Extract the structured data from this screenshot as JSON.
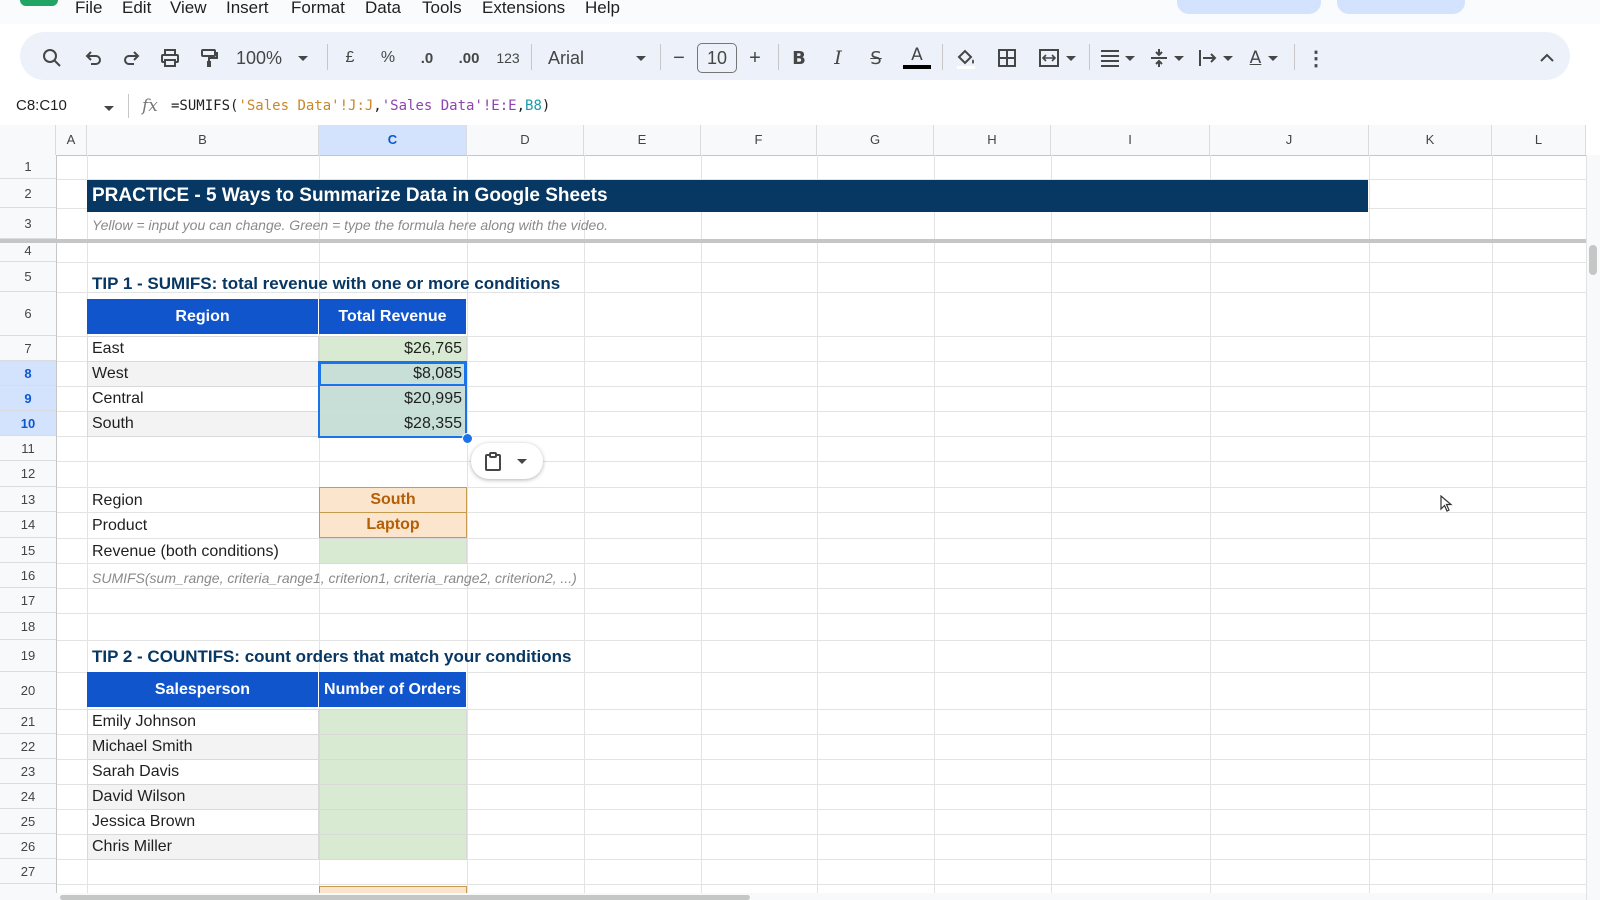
{
  "menu": {
    "items": [
      "File",
      "Edit",
      "View",
      "Insert",
      "Format",
      "Data",
      "Tools",
      "Extensions",
      "Help"
    ]
  },
  "toolbar": {
    "zoom": "100%",
    "currency": "£",
    "percent": "%",
    "dec_decrease": ".0",
    "dec_increase": ".00",
    "number_format": "123",
    "font": "Arial",
    "font_size": "10",
    "minus": "−",
    "plus": "+"
  },
  "formula_bar": {
    "name_box": "C8:C10",
    "fx": "fx",
    "formula": "=SUMIFS('Sales Data'!J:J,'Sales Data'!E:E,B8)"
  },
  "columns": [
    "A",
    "B",
    "C",
    "D",
    "E",
    "F",
    "G",
    "H",
    "I",
    "J",
    "K",
    "L"
  ],
  "rows": [
    "1",
    "2",
    "3",
    "4",
    "5",
    "6",
    "7",
    "8",
    "9",
    "10",
    "11",
    "12",
    "13",
    "14",
    "15",
    "16",
    "17",
    "18",
    "19",
    "20",
    "21",
    "22",
    "23",
    "24",
    "25",
    "26",
    "27"
  ],
  "sheet": {
    "banner": "PRACTICE  -  5 Ways to Summarize Data in Google Sheets",
    "subtitle": "Yellow = input you can change.  Green = type the formula here along with the video.",
    "tip1": {
      "title": "TIP 1  -  SUMIFS: total revenue with one or more conditions",
      "headers": [
        "Region",
        "Total Revenue"
      ],
      "rows": [
        {
          "region": "East",
          "revenue": "$26,765"
        },
        {
          "region": "West",
          "revenue": "$8,085"
        },
        {
          "region": "Central",
          "revenue": "$20,995"
        },
        {
          "region": "South",
          "revenue": "$28,355"
        }
      ],
      "region_label": "Region",
      "region_value": "South",
      "product_label": "Product",
      "product_value": "Laptop",
      "both_label": "Revenue (both conditions)",
      "syntax": "SUMIFS(sum_range, criteria_range1, criterion1, criteria_range2, criterion2, ...)"
    },
    "tip2": {
      "title": "TIP 2  -  COUNTIFS: count orders that match your conditions",
      "headers": [
        "Salesperson",
        "Number of Orders"
      ],
      "people": [
        "Emily Johnson",
        "Michael Smith",
        "Sarah Davis",
        "David Wilson",
        "Jessica Brown",
        "Chris Miller"
      ]
    }
  },
  "colors": {
    "banner": "#073763",
    "header": "#1155cc",
    "green_input": "#d9ead3",
    "yellow_input": "#fce5cd",
    "selection": "#1a73e8"
  }
}
